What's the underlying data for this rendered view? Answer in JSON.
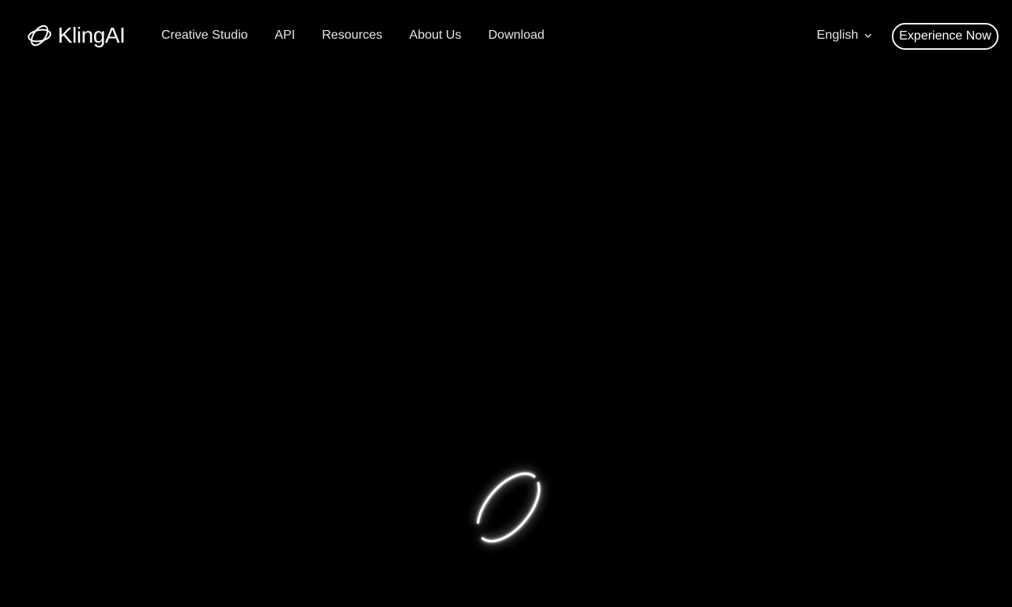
{
  "header": {
    "brand": "KlingAI",
    "nav": [
      {
        "label": "Creative Studio"
      },
      {
        "label": "API"
      },
      {
        "label": "Resources"
      },
      {
        "label": "About Us"
      },
      {
        "label": "Download"
      }
    ],
    "language": {
      "label": "English",
      "icon": "chevron-down-icon"
    },
    "cta_label": "Experience Now"
  },
  "hero": {
    "loader_icon": "orbit-ring-icon"
  },
  "colors": {
    "background": "#000000",
    "text": "#e6e6e6",
    "accent": "#ffffff"
  }
}
